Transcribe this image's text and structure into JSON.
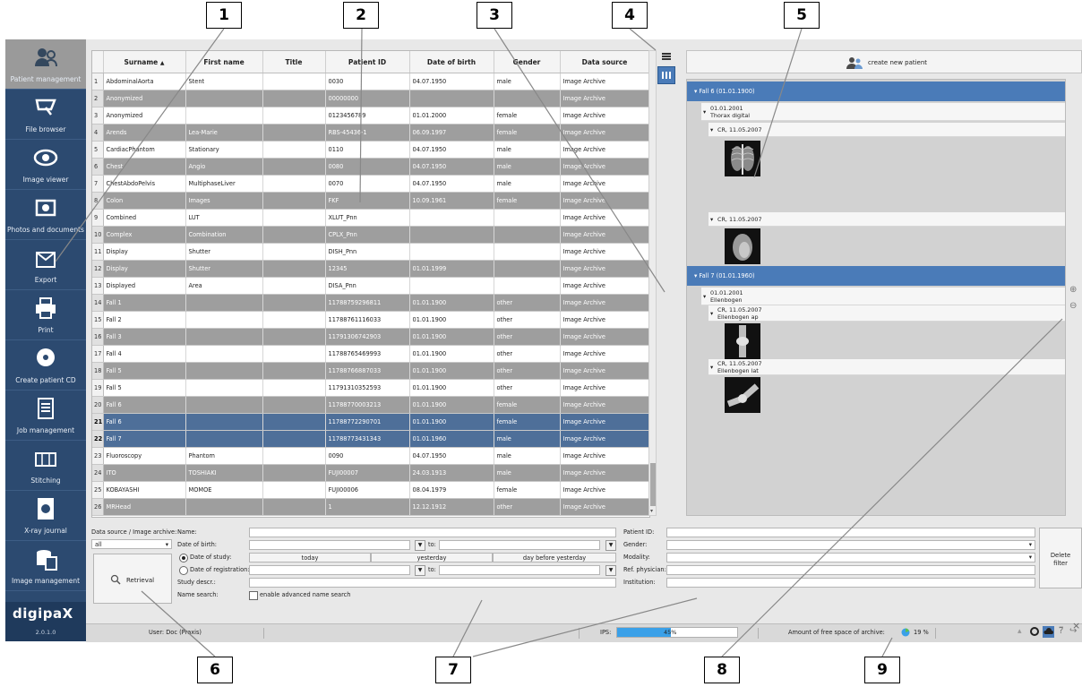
{
  "callouts": [
    "1",
    "2",
    "3",
    "4",
    "5",
    "6",
    "7",
    "8",
    "9"
  ],
  "nav": [
    {
      "label": "Patient management",
      "icon": "patient-icon"
    },
    {
      "label": "File browser",
      "icon": "file-browser-icon"
    },
    {
      "label": "Image viewer",
      "icon": "eye-icon"
    },
    {
      "label": "Photos and documents",
      "icon": "camera-icon"
    },
    {
      "label": "Export",
      "icon": "export-icon"
    },
    {
      "label": "Print",
      "icon": "printer-icon"
    },
    {
      "label": "Create patient CD",
      "icon": "cd-icon"
    },
    {
      "label": "Job management",
      "icon": "job-list-icon"
    },
    {
      "label": "Stitching",
      "icon": "stitching-icon"
    },
    {
      "label": "X-ray journal",
      "icon": "xray-journal-icon"
    },
    {
      "label": "Image management",
      "icon": "image-management-icon"
    }
  ],
  "logo": {
    "text": "digipaX",
    "version": "2.0.1.0"
  },
  "table": {
    "columns": [
      "Surname",
      "First name",
      "Title",
      "Patient ID",
      "Date of birth",
      "Gender",
      "Data source"
    ],
    "rows": [
      [
        "1",
        "AbdominalAorta",
        "Stent",
        "",
        "0030",
        "04.07.1950",
        "male",
        "Image Archive"
      ],
      [
        "2",
        "Anonymized",
        "",
        "",
        "00000000",
        "",
        "",
        "Image Archive"
      ],
      [
        "3",
        "Anonymized",
        "",
        "",
        "0123456789",
        "01.01.2000",
        "female",
        "Image Archive"
      ],
      [
        "4",
        "Arends",
        "Lea-Marie",
        "",
        "RBS-45436-1",
        "06.09.1997",
        "female",
        "Image Archive"
      ],
      [
        "5",
        "CardiacPhantom",
        "Stationary",
        "",
        "0110",
        "04.07.1950",
        "male",
        "Image Archive"
      ],
      [
        "6",
        "Chest",
        "Angio",
        "",
        "0080",
        "04.07.1950",
        "male",
        "Image Archive"
      ],
      [
        "7",
        "ChestAbdoPelvis",
        "MultiphaseLiver",
        "",
        "0070",
        "04.07.1950",
        "male",
        "Image Archive"
      ],
      [
        "8",
        "Colon",
        "Images",
        "",
        "FKF",
        "10.09.1961",
        "female",
        "Image Archive"
      ],
      [
        "9",
        "Combined",
        "LUT",
        "",
        "XLUT_Pnn",
        "",
        "",
        "Image Archive"
      ],
      [
        "10",
        "Complex",
        "Combination",
        "",
        "CPLX_Pnn",
        "",
        "",
        "Image Archive"
      ],
      [
        "11",
        "Display",
        "Shutter",
        "",
        "DISH_Pnn",
        "",
        "",
        "Image Archive"
      ],
      [
        "12",
        "Display",
        "Shutter",
        "",
        "12345",
        "01.01.1999",
        "",
        "Image Archive"
      ],
      [
        "13",
        "Displayed",
        "Area",
        "",
        "DISA_Pnn",
        "",
        "",
        "Image Archive"
      ],
      [
        "14",
        "Fall 1",
        "",
        "",
        "11788759296811",
        "01.01.1900",
        "other",
        "Image Archive"
      ],
      [
        "15",
        "Fall 2",
        "",
        "",
        "11788761116033",
        "01.01.1900",
        "other",
        "Image Archive"
      ],
      [
        "16",
        "Fall 3",
        "",
        "",
        "11791306742903",
        "01.01.1900",
        "other",
        "Image Archive"
      ],
      [
        "17",
        "Fall 4",
        "",
        "",
        "11788765469993",
        "01.01.1900",
        "other",
        "Image Archive"
      ],
      [
        "18",
        "Fall 5",
        "",
        "",
        "11788766887033",
        "01.01.1900",
        "other",
        "Image Archive"
      ],
      [
        "19",
        "Fall 5",
        "",
        "",
        "11791310352593",
        "01.01.1900",
        "other",
        "Image Archive"
      ],
      [
        "20",
        "Fall 6",
        "",
        "",
        "11788770003213",
        "01.01.1900",
        "female",
        "Image Archive"
      ],
      [
        "21",
        "Fall 6",
        "",
        "",
        "11788772290701",
        "01.01.1900",
        "female",
        "Image Archive"
      ],
      [
        "22",
        "Fall 7",
        "",
        "",
        "11788773431343",
        "01.01.1960",
        "male",
        "Image Archive"
      ],
      [
        "23",
        "Fluoroscopy",
        "Phantom",
        "",
        "0090",
        "04.07.1950",
        "male",
        "Image Archive"
      ],
      [
        "24",
        "ITO",
        "TOSHIAKI",
        "",
        "FUJI00007",
        "24.03.1913",
        "male",
        "Image Archive"
      ],
      [
        "25",
        "KOBAYASHI",
        "MOMOE",
        "",
        "FUJI00006",
        "08.04.1979",
        "female",
        "Image Archive"
      ],
      [
        "26",
        "MRHead",
        "",
        "",
        "1",
        "12.12.1912",
        "other",
        "Image Archive"
      ]
    ],
    "selected_rows": [
      21,
      22
    ]
  },
  "create_patient_label": "create new patient",
  "tree": {
    "fall6": "Fall 6 (01.01.1900)",
    "study1_date": "01.01.2001",
    "study1_desc": "Thorax digital",
    "series1": "CR, 11.05.2007",
    "series2": "CR, 11.05.2007",
    "fall7": "Fall 7 (01.01.1960)",
    "study2_date": "01.01.2001",
    "study2_desc": "Ellenbogen",
    "series3_date": "CR, 11.05.2007",
    "series3_desc": "Ellenbogen ap",
    "series4_date": "CR, 11.05.2007",
    "series4_desc": "Ellenbogen lat"
  },
  "filter": {
    "data_source_label": "Data source / Image archive:",
    "data_source_value": "all",
    "name_label": "Name:",
    "dob_label": "Date of birth:",
    "to_label": "to:",
    "date_of_study_label": "Date of study:",
    "today": "today",
    "yesterday": "yesterday",
    "day_before_yesterday": "day before yesterday",
    "date_of_registration_label": "Date of registration:",
    "study_descr_label": "Study descr.:",
    "name_search_label": "Name search:",
    "advanced_label": "enable advanced name search",
    "retrieval_label": "Retrieval",
    "patient_id_label": "Patient ID:",
    "gender_label": "Gender:",
    "modality_label": "Modality:",
    "ref_physician_label": "Ref. physician:",
    "institution_label": "Institution:",
    "delete_filter_line1": "Delete",
    "delete_filter_line2": "filter"
  },
  "status": {
    "user": "User: Doc (Praxis)",
    "ips_label": "IPS:",
    "ips_value": "45%",
    "ips_fraction": 0.45,
    "free_space_label": "Amount of free space of archive:",
    "free_space_value": "19 %"
  },
  "colors": {
    "sidebar": "#2c4a70",
    "selected": "#4e6f99",
    "tree_header": "#4a7bb8",
    "progress": "#3aa0e8"
  }
}
